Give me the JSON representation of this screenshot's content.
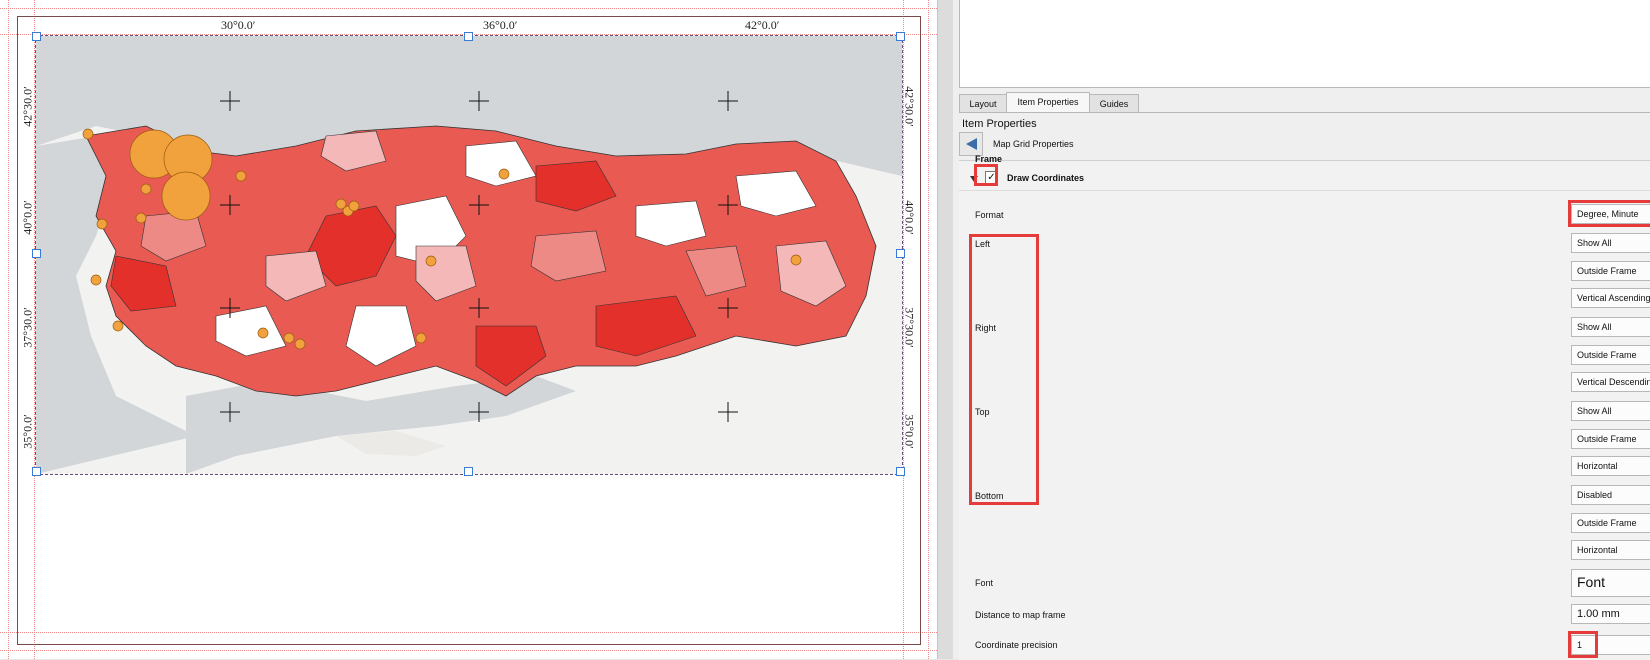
{
  "map": {
    "top_coords": [
      "30°0.0′",
      "36°0.0′",
      "42°0.0′"
    ],
    "left_coords": [
      "42°30.0′",
      "40°0.0′",
      "37°30.0′",
      "35°0.0′"
    ],
    "right_coords": [
      "42°30.0′",
      "40°0.0′",
      "37°30.0′",
      "35°0.0′"
    ],
    "colors": {
      "sea": "#d2d6d9",
      "land": "#f2f2f0",
      "choropleth": [
        "#ffffff",
        "#f4b8b8",
        "#ee8a86",
        "#e85a52",
        "#e4302a"
      ],
      "points": "#f2a23c"
    }
  },
  "panel": {
    "tabs": [
      "Layout",
      "Item Properties",
      "Guides"
    ],
    "active_tab": "Item Properties",
    "title": "Item Properties",
    "subtitle": "Map Grid Properties",
    "frame_label": "Frame",
    "draw_coordinates_label": "Draw Coordinates",
    "draw_coordinates_checked": true,
    "format_label": "Format",
    "format_value": "Degree, Minute",
    "left_label": "Left",
    "left_show": "Show All",
    "left_position": "Outside Frame",
    "left_direction": "Vertical Ascending",
    "right_label": "Right",
    "right_show": "Show All",
    "right_position": "Outside Frame",
    "right_direction": "Vertical Descending",
    "top_label": "Top",
    "top_show": "Show All",
    "top_position": "Outside Frame",
    "top_direction": "Horizontal",
    "bottom_label": "Bottom",
    "bottom_show": "Disabled",
    "bottom_position": "Outside Frame",
    "bottom_direction": "Horizontal",
    "font_label": "Font",
    "font_button": "Font",
    "distance_label": "Distance to map frame",
    "distance_value": "1.00 mm",
    "precision_label": "Coordinate precision",
    "precision_value": "1"
  }
}
